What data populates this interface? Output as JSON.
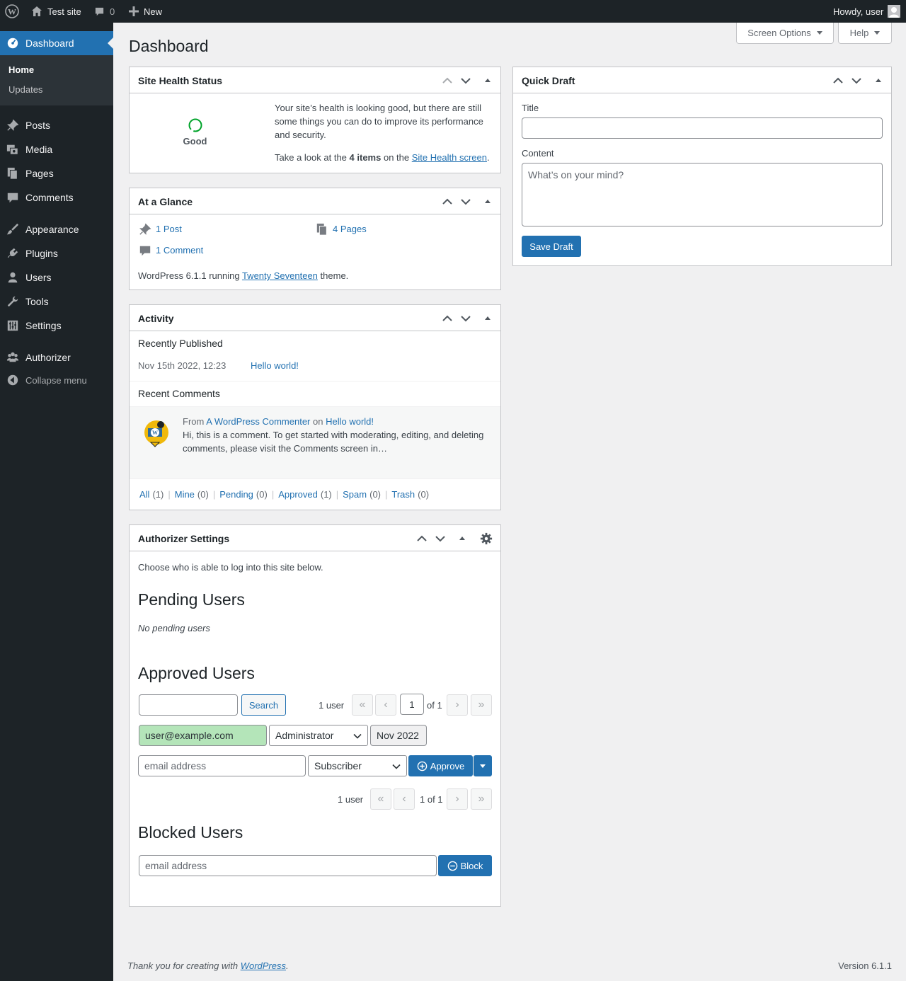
{
  "admin_bar": {
    "site_name": "Test site",
    "comments_count": "0",
    "new_label": "New",
    "howdy": "Howdy, user"
  },
  "menu": {
    "dashboard": "Dashboard",
    "home": "Home",
    "updates": "Updates",
    "posts": "Posts",
    "media": "Media",
    "pages": "Pages",
    "comments": "Comments",
    "appearance": "Appearance",
    "plugins": "Plugins",
    "users": "Users",
    "tools": "Tools",
    "settings": "Settings",
    "authorizer": "Authorizer",
    "collapse": "Collapse menu"
  },
  "page": {
    "title": "Dashboard",
    "screen_options": "Screen Options",
    "help": "Help"
  },
  "site_health": {
    "title": "Site Health Status",
    "status": "Good",
    "message": "Your site’s health is looking good, but there are still some things you can do to improve its performance and security.",
    "take_look_prefix": "Take a look at the",
    "items": "4 items",
    "on_the": "on the",
    "link": "Site Health screen",
    "suffix": "."
  },
  "at_a_glance": {
    "title": "At a Glance",
    "posts": "1 Post",
    "pages": "4 Pages",
    "comments": "1 Comment",
    "version_prefix": "WordPress 6.1.1 running",
    "theme": "Twenty Seventeen",
    "version_suffix": "theme."
  },
  "activity": {
    "title": "Activity",
    "recently_published": "Recently Published",
    "pub_date": "Nov 15th 2022, 12:23",
    "pub_title": "Hello world!",
    "recent_comments": "Recent Comments",
    "comment_from": "From",
    "comment_author": "A WordPress Commenter",
    "comment_on": "on",
    "comment_post": "Hello world!",
    "comment_text": "Hi, this is a comment. To get started with moderating, editing, and deleting comments, please visit the Comments screen in…",
    "filters": [
      {
        "label": "All",
        "count": "(1)"
      },
      {
        "label": "Mine",
        "count": "(0)"
      },
      {
        "label": "Pending",
        "count": "(0)"
      },
      {
        "label": "Approved",
        "count": "(1)"
      },
      {
        "label": "Spam",
        "count": "(0)"
      },
      {
        "label": "Trash",
        "count": "(0)"
      }
    ]
  },
  "authorizer": {
    "title": "Authorizer Settings",
    "intro": "Choose who is able to log into this site below.",
    "pending_heading": "Pending Users",
    "no_pending": "No pending users",
    "approved_heading": "Approved Users",
    "search_label": "Search",
    "user_count": "1 user",
    "page_current": "1",
    "page_of": "of 1",
    "page_of_bottom": "1 of 1",
    "approved_email": "user@example.com",
    "approved_role": "Administrator",
    "approved_date": "Nov 2022",
    "new_email_placeholder": "email address",
    "new_role": "Subscriber",
    "approve_label": "Approve",
    "blocked_heading": "Blocked Users",
    "block_placeholder": "email address",
    "block_label": "Block"
  },
  "quick_draft": {
    "title": "Quick Draft",
    "title_label": "Title",
    "content_label": "Content",
    "content_placeholder": "What’s on your mind?",
    "save": "Save Draft"
  },
  "footer": {
    "thanks_prefix": "Thank you for creating with",
    "wordpress": "WordPress",
    "period": ".",
    "version": "Version 6.1.1"
  },
  "colors": {
    "admin_bar": "#1d2327",
    "accent": "#2271b1",
    "good": "#00a32a",
    "approved_user_bg": "#b4e5b9"
  }
}
